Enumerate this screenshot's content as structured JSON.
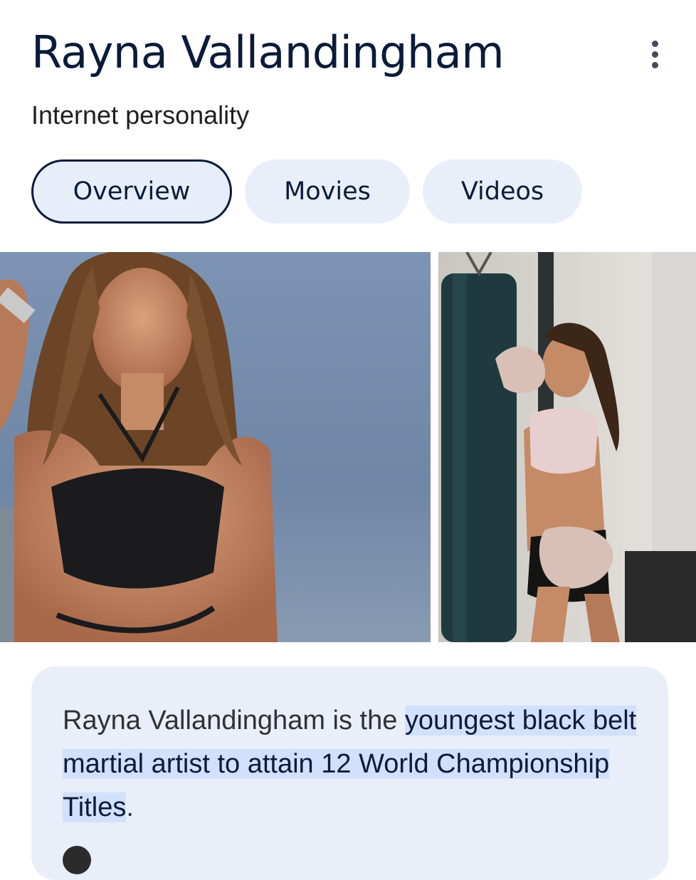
{
  "entity": {
    "name": "Rayna Vallandingham",
    "type": "Internet personality"
  },
  "tabs": [
    {
      "label": "Overview",
      "active": true
    },
    {
      "label": "Movies",
      "active": false
    },
    {
      "label": "Videos",
      "active": false
    }
  ],
  "images": [
    {
      "subject": "woman-in-black-halter-top-sky-background"
    },
    {
      "subject": "woman-in-gym-with-boxing-gloves-and-punching-bag"
    }
  ],
  "description": {
    "plain": "Rayna Vallandingham is the ",
    "highlight": "youngest black belt martial artist to attain 12 World Championship Titles",
    "end": "."
  },
  "icons": {
    "more": "more-vert-icon"
  },
  "colors": {
    "title": "#0b1b3a",
    "chip_bg": "#e9eef9",
    "card_bg": "#e9eef9",
    "highlight": "#d1e0fb"
  }
}
